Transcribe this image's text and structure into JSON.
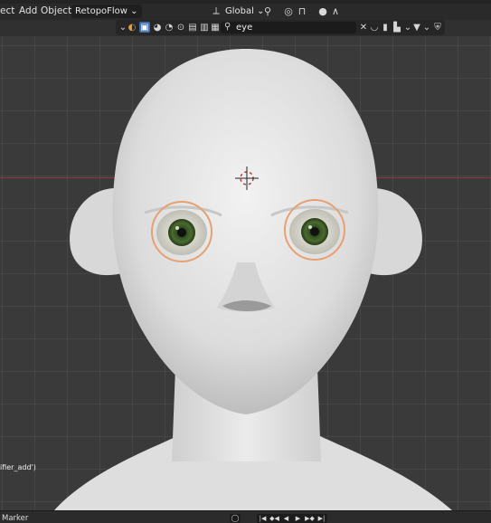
{
  "menubar": {
    "items": [
      "ect",
      "Add",
      "Object"
    ],
    "addon_dropdown": "RetopoFlow ⌄",
    "orientation_dropdown": "Global ⌄",
    "icons": [
      "transform-pivot-icon",
      "snap-icon",
      "proportional-editing-icon",
      "falloff-icon"
    ]
  },
  "header2": {
    "search_value": "eye",
    "icons": [
      "object-type-icon",
      "material-icon",
      "viewport-shading-icon",
      "render-icon",
      "scene-icon",
      "camera-icon",
      "filter-icon",
      "clear-icon",
      "bookmark-icon",
      "view-layer-icon",
      "funnel-icon",
      "shield-icon"
    ]
  },
  "viewport": {
    "side_text": "ifier_add')",
    "iris_color": "#4a6b2f",
    "selection_color": "#e8a070"
  },
  "timeline": {
    "marker_label": "Marker"
  }
}
